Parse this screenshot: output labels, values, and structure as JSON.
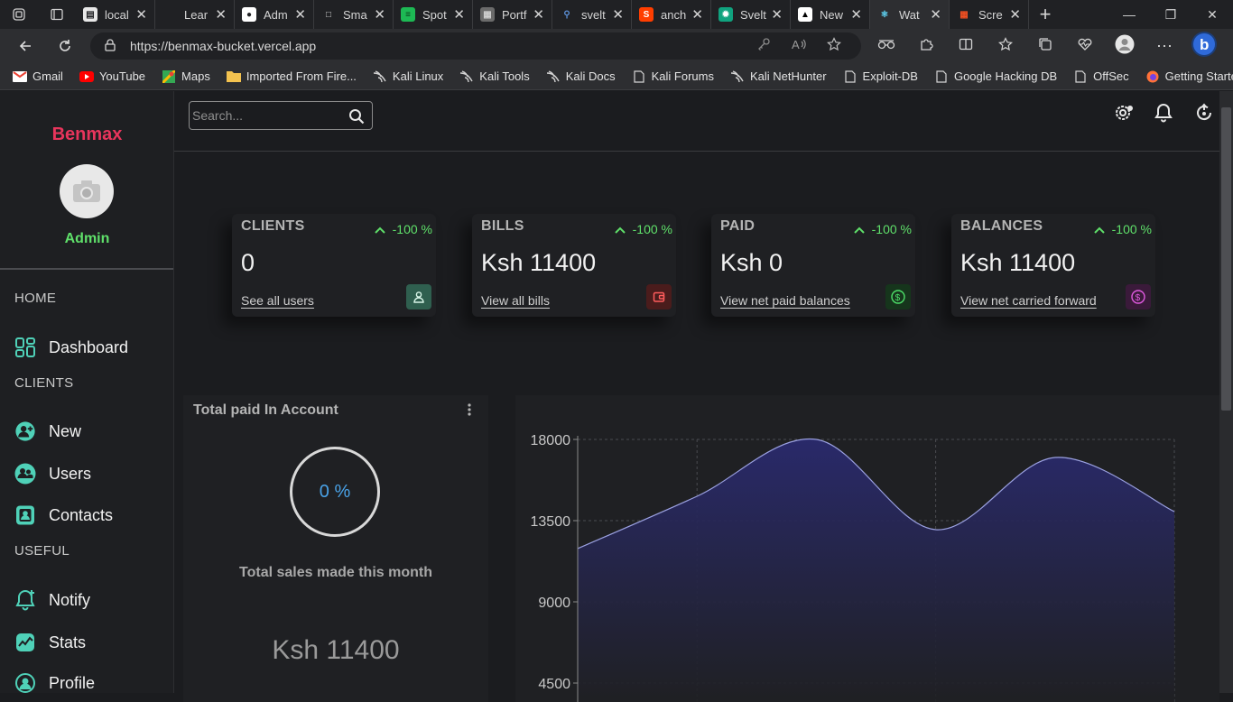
{
  "browser": {
    "tabs": [
      {
        "title": "local",
        "icon": "document-icon",
        "active": false
      },
      {
        "title": "Lear",
        "icon": "learn-icon",
        "active": false
      },
      {
        "title": "Adm",
        "icon": "github-icon",
        "active": false
      },
      {
        "title": "Sma",
        "icon": "page-icon",
        "active": false
      },
      {
        "title": "Spot",
        "icon": "spotify-icon",
        "active": false
      },
      {
        "title": "Portf",
        "icon": "portfolio-icon",
        "active": false
      },
      {
        "title": "svelt",
        "icon": "search-icon",
        "active": false
      },
      {
        "title": "anch",
        "icon": "svelte-icon",
        "active": false
      },
      {
        "title": "Svelt",
        "icon": "openai-icon",
        "active": false
      },
      {
        "title": "New",
        "icon": "triangle-icon",
        "active": false
      },
      {
        "title": "Wat",
        "icon": "react-icon",
        "active": true
      },
      {
        "title": "Scre",
        "icon": "microsoft-icon",
        "active": false
      }
    ],
    "url": "https://benmax-bucket.vercel.app",
    "bookmarks": [
      {
        "label": "Gmail",
        "icon": "gmail-icon"
      },
      {
        "label": "YouTube",
        "icon": "youtube-icon"
      },
      {
        "label": "Maps",
        "icon": "maps-icon"
      },
      {
        "label": "Imported From Fire...",
        "icon": "folder-icon"
      },
      {
        "label": "Kali Linux",
        "icon": "kali-icon"
      },
      {
        "label": "Kali Tools",
        "icon": "kali-icon"
      },
      {
        "label": "Kali Docs",
        "icon": "kali-icon"
      },
      {
        "label": "Kali Forums",
        "icon": "page-icon"
      },
      {
        "label": "Kali NetHunter",
        "icon": "kali-icon"
      },
      {
        "label": "Exploit-DB",
        "icon": "page-icon"
      },
      {
        "label": "Google Hacking DB",
        "icon": "page-icon"
      },
      {
        "label": "OffSec",
        "icon": "page-icon"
      },
      {
        "label": "Getting Started",
        "icon": "firefox-icon"
      }
    ]
  },
  "sidebar": {
    "brand": "Benmax",
    "role": "Admin",
    "sections": {
      "home": "HOME",
      "clients": "CLIENTS",
      "useful": "USEFUL"
    },
    "items": {
      "dashboard": "Dashboard",
      "new": "New",
      "users": "Users",
      "contacts": "Contacts",
      "notify": "Notify",
      "stats": "Stats",
      "profile": "Profile"
    }
  },
  "search": {
    "placeholder": "Search..."
  },
  "cards": [
    {
      "title": "CLIENTS",
      "change": "-100 %",
      "value": "0",
      "link": "See all users",
      "icon": "user-icon",
      "icon_color": "#2f5f4f",
      "icon_fg": "#d8f5e8"
    },
    {
      "title": "BILLS",
      "change": "-100 %",
      "value": "Ksh 11400",
      "link": "View all bills",
      "icon": "wallet-icon",
      "icon_color": "#4a1c1c",
      "icon_fg": "#ff5c5c"
    },
    {
      "title": "PAID",
      "change": "-100 %",
      "value": "Ksh 0",
      "link": "View net paid balances",
      "icon": "dollar-icon",
      "icon_color": "#16351c",
      "icon_fg": "#4ee06a"
    },
    {
      "title": "BALANCES",
      "change": "-100 %",
      "value": "Ksh 11400",
      "link": "View net carried forward",
      "icon": "dollar-icon",
      "icon_color": "#3a1a3a",
      "icon_fg": "#e05ae0"
    }
  ],
  "summary": {
    "title": "Total paid In Account",
    "percent": "0 %",
    "subtitle": "Total sales made this month",
    "amount": "Ksh 11400"
  },
  "chart_data": {
    "type": "area",
    "title": "",
    "xlabel": "",
    "ylabel": "",
    "y_ticks": [
      "18000",
      "13500",
      "9000",
      "4500"
    ],
    "ylim": [
      4500,
      18000
    ],
    "x": [
      0,
      1,
      2,
      3,
      4,
      5
    ],
    "values": [
      11950,
      14850,
      18000,
      13000,
      17000,
      14000
    ],
    "grid": true,
    "colors": {
      "fill": "#2a2a6e",
      "line": "#9aa0e0"
    }
  }
}
